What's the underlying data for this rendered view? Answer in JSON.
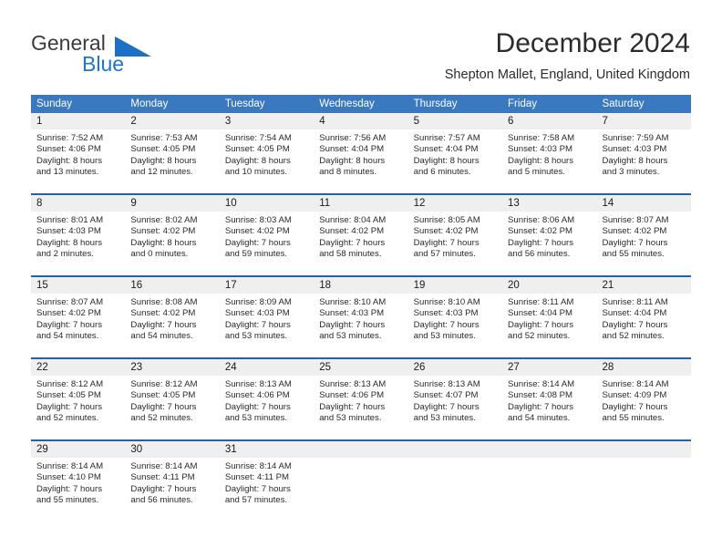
{
  "brand": {
    "line1": "General",
    "line2": "Blue",
    "triangle_color": "#1f6fc4",
    "line1_color": "#3b3b3b",
    "line2_color": "#2076c6"
  },
  "header": {
    "month_title": "December 2024",
    "location": "Shepton Mallet, England, United Kingdom"
  },
  "theme": {
    "header_bg": "#3a78bf",
    "header_text": "#ffffff",
    "daynum_bg": "#efefef",
    "week_separator": "#1f63ab",
    "body_bg": "#ffffff"
  },
  "weekdays": [
    "Sunday",
    "Monday",
    "Tuesday",
    "Wednesday",
    "Thursday",
    "Friday",
    "Saturday"
  ],
  "weeks": [
    [
      {
        "day": "1",
        "sunrise": "Sunrise: 7:52 AM",
        "sunset": "Sunset: 4:06 PM",
        "daylight1": "Daylight: 8 hours",
        "daylight2": "and 13 minutes."
      },
      {
        "day": "2",
        "sunrise": "Sunrise: 7:53 AM",
        "sunset": "Sunset: 4:05 PM",
        "daylight1": "Daylight: 8 hours",
        "daylight2": "and 12 minutes."
      },
      {
        "day": "3",
        "sunrise": "Sunrise: 7:54 AM",
        "sunset": "Sunset: 4:05 PM",
        "daylight1": "Daylight: 8 hours",
        "daylight2": "and 10 minutes."
      },
      {
        "day": "4",
        "sunrise": "Sunrise: 7:56 AM",
        "sunset": "Sunset: 4:04 PM",
        "daylight1": "Daylight: 8 hours",
        "daylight2": "and 8 minutes."
      },
      {
        "day": "5",
        "sunrise": "Sunrise: 7:57 AM",
        "sunset": "Sunset: 4:04 PM",
        "daylight1": "Daylight: 8 hours",
        "daylight2": "and 6 minutes."
      },
      {
        "day": "6",
        "sunrise": "Sunrise: 7:58 AM",
        "sunset": "Sunset: 4:03 PM",
        "daylight1": "Daylight: 8 hours",
        "daylight2": "and 5 minutes."
      },
      {
        "day": "7",
        "sunrise": "Sunrise: 7:59 AM",
        "sunset": "Sunset: 4:03 PM",
        "daylight1": "Daylight: 8 hours",
        "daylight2": "and 3 minutes."
      }
    ],
    [
      {
        "day": "8",
        "sunrise": "Sunrise: 8:01 AM",
        "sunset": "Sunset: 4:03 PM",
        "daylight1": "Daylight: 8 hours",
        "daylight2": "and 2 minutes."
      },
      {
        "day": "9",
        "sunrise": "Sunrise: 8:02 AM",
        "sunset": "Sunset: 4:02 PM",
        "daylight1": "Daylight: 8 hours",
        "daylight2": "and 0 minutes."
      },
      {
        "day": "10",
        "sunrise": "Sunrise: 8:03 AM",
        "sunset": "Sunset: 4:02 PM",
        "daylight1": "Daylight: 7 hours",
        "daylight2": "and 59 minutes."
      },
      {
        "day": "11",
        "sunrise": "Sunrise: 8:04 AM",
        "sunset": "Sunset: 4:02 PM",
        "daylight1": "Daylight: 7 hours",
        "daylight2": "and 58 minutes."
      },
      {
        "day": "12",
        "sunrise": "Sunrise: 8:05 AM",
        "sunset": "Sunset: 4:02 PM",
        "daylight1": "Daylight: 7 hours",
        "daylight2": "and 57 minutes."
      },
      {
        "day": "13",
        "sunrise": "Sunrise: 8:06 AM",
        "sunset": "Sunset: 4:02 PM",
        "daylight1": "Daylight: 7 hours",
        "daylight2": "and 56 minutes."
      },
      {
        "day": "14",
        "sunrise": "Sunrise: 8:07 AM",
        "sunset": "Sunset: 4:02 PM",
        "daylight1": "Daylight: 7 hours",
        "daylight2": "and 55 minutes."
      }
    ],
    [
      {
        "day": "15",
        "sunrise": "Sunrise: 8:07 AM",
        "sunset": "Sunset: 4:02 PM",
        "daylight1": "Daylight: 7 hours",
        "daylight2": "and 54 minutes."
      },
      {
        "day": "16",
        "sunrise": "Sunrise: 8:08 AM",
        "sunset": "Sunset: 4:02 PM",
        "daylight1": "Daylight: 7 hours",
        "daylight2": "and 54 minutes."
      },
      {
        "day": "17",
        "sunrise": "Sunrise: 8:09 AM",
        "sunset": "Sunset: 4:03 PM",
        "daylight1": "Daylight: 7 hours",
        "daylight2": "and 53 minutes."
      },
      {
        "day": "18",
        "sunrise": "Sunrise: 8:10 AM",
        "sunset": "Sunset: 4:03 PM",
        "daylight1": "Daylight: 7 hours",
        "daylight2": "and 53 minutes."
      },
      {
        "day": "19",
        "sunrise": "Sunrise: 8:10 AM",
        "sunset": "Sunset: 4:03 PM",
        "daylight1": "Daylight: 7 hours",
        "daylight2": "and 53 minutes."
      },
      {
        "day": "20",
        "sunrise": "Sunrise: 8:11 AM",
        "sunset": "Sunset: 4:04 PM",
        "daylight1": "Daylight: 7 hours",
        "daylight2": "and 52 minutes."
      },
      {
        "day": "21",
        "sunrise": "Sunrise: 8:11 AM",
        "sunset": "Sunset: 4:04 PM",
        "daylight1": "Daylight: 7 hours",
        "daylight2": "and 52 minutes."
      }
    ],
    [
      {
        "day": "22",
        "sunrise": "Sunrise: 8:12 AM",
        "sunset": "Sunset: 4:05 PM",
        "daylight1": "Daylight: 7 hours",
        "daylight2": "and 52 minutes."
      },
      {
        "day": "23",
        "sunrise": "Sunrise: 8:12 AM",
        "sunset": "Sunset: 4:05 PM",
        "daylight1": "Daylight: 7 hours",
        "daylight2": "and 52 minutes."
      },
      {
        "day": "24",
        "sunrise": "Sunrise: 8:13 AM",
        "sunset": "Sunset: 4:06 PM",
        "daylight1": "Daylight: 7 hours",
        "daylight2": "and 53 minutes."
      },
      {
        "day": "25",
        "sunrise": "Sunrise: 8:13 AM",
        "sunset": "Sunset: 4:06 PM",
        "daylight1": "Daylight: 7 hours",
        "daylight2": "and 53 minutes."
      },
      {
        "day": "26",
        "sunrise": "Sunrise: 8:13 AM",
        "sunset": "Sunset: 4:07 PM",
        "daylight1": "Daylight: 7 hours",
        "daylight2": "and 53 minutes."
      },
      {
        "day": "27",
        "sunrise": "Sunrise: 8:14 AM",
        "sunset": "Sunset: 4:08 PM",
        "daylight1": "Daylight: 7 hours",
        "daylight2": "and 54 minutes."
      },
      {
        "day": "28",
        "sunrise": "Sunrise: 8:14 AM",
        "sunset": "Sunset: 4:09 PM",
        "daylight1": "Daylight: 7 hours",
        "daylight2": "and 55 minutes."
      }
    ],
    [
      {
        "day": "29",
        "sunrise": "Sunrise: 8:14 AM",
        "sunset": "Sunset: 4:10 PM",
        "daylight1": "Daylight: 7 hours",
        "daylight2": "and 55 minutes."
      },
      {
        "day": "30",
        "sunrise": "Sunrise: 8:14 AM",
        "sunset": "Sunset: 4:11 PM",
        "daylight1": "Daylight: 7 hours",
        "daylight2": "and 56 minutes."
      },
      {
        "day": "31",
        "sunrise": "Sunrise: 8:14 AM",
        "sunset": "Sunset: 4:11 PM",
        "daylight1": "Daylight: 7 hours",
        "daylight2": "and 57 minutes."
      },
      {
        "day": "",
        "sunrise": "",
        "sunset": "",
        "daylight1": "",
        "daylight2": ""
      },
      {
        "day": "",
        "sunrise": "",
        "sunset": "",
        "daylight1": "",
        "daylight2": ""
      },
      {
        "day": "",
        "sunrise": "",
        "sunset": "",
        "daylight1": "",
        "daylight2": ""
      },
      {
        "day": "",
        "sunrise": "",
        "sunset": "",
        "daylight1": "",
        "daylight2": ""
      }
    ]
  ]
}
